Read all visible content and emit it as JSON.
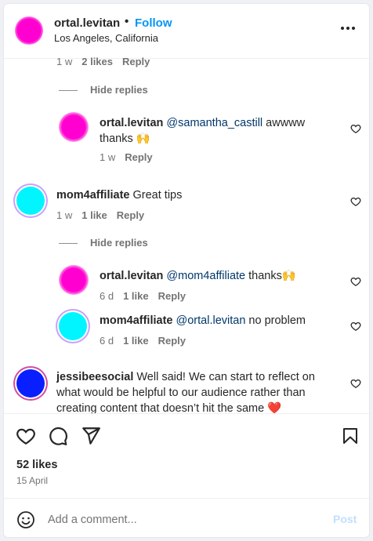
{
  "header": {
    "username": "ortal.levitan",
    "separator": "•",
    "follow_label": "Follow",
    "location": "Los Angeles, California",
    "more_icon": "more-horizontal-icon"
  },
  "comments": {
    "top_partial": {
      "time": "1 w",
      "likes": "2 likes",
      "reply": "Reply"
    },
    "hide_replies_1": "Hide replies",
    "reply_1": {
      "username": "ortal.levitan",
      "mention": "@samantha_castill",
      "text": " awwww thanks 🙌",
      "time": "1 w",
      "reply": "Reply"
    },
    "comment_2": {
      "username": "mom4affiliate",
      "text": " Great tips",
      "time": "1 w",
      "likes": "1 like",
      "reply": "Reply"
    },
    "hide_replies_2": "Hide replies",
    "reply_2": {
      "username": "ortal.levitan",
      "mention": "@mom4affiliate",
      "text": " thanks🙌",
      "time": "6 d",
      "likes": "1 like",
      "reply": "Reply"
    },
    "reply_3": {
      "username": "mom4affiliate",
      "mention": "@ortal.levitan",
      "text": " no problem",
      "time": "6 d",
      "likes": "1 like",
      "reply": "Reply"
    },
    "comment_3": {
      "username": "jessibeesocial",
      "text": " Well said! We can start to reflect on what would be helpful to our audience rather than creating content that doesn’t hit the same ❤️"
    }
  },
  "actions": {
    "like_icon": "heart-icon",
    "comment_icon": "comment-icon",
    "share_icon": "share-icon",
    "save_icon": "bookmark-icon",
    "likes_count": "52 likes",
    "date": "15 April"
  },
  "composer": {
    "placeholder": "Add a comment...",
    "post_label": "Post",
    "emoji_icon": "emoji-icon"
  },
  "colors": {
    "accent": "#0095f6",
    "post_disabled": "#c0dffd",
    "mention": "#00376b"
  }
}
